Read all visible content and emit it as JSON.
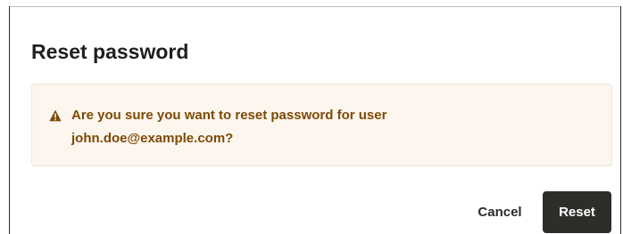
{
  "dialog": {
    "title": "Reset password",
    "warning": {
      "icon": "warning-triangle-icon",
      "line1": "Are you sure you want to reset password for user",
      "line2": "john.doe@example.com?"
    },
    "buttons": {
      "cancel_label": "Cancel",
      "reset_label": "Reset"
    }
  },
  "colors": {
    "warning_background": "#fcf6ef",
    "warning_text": "#7d4a05",
    "primary_button": "#2f2d2a"
  }
}
